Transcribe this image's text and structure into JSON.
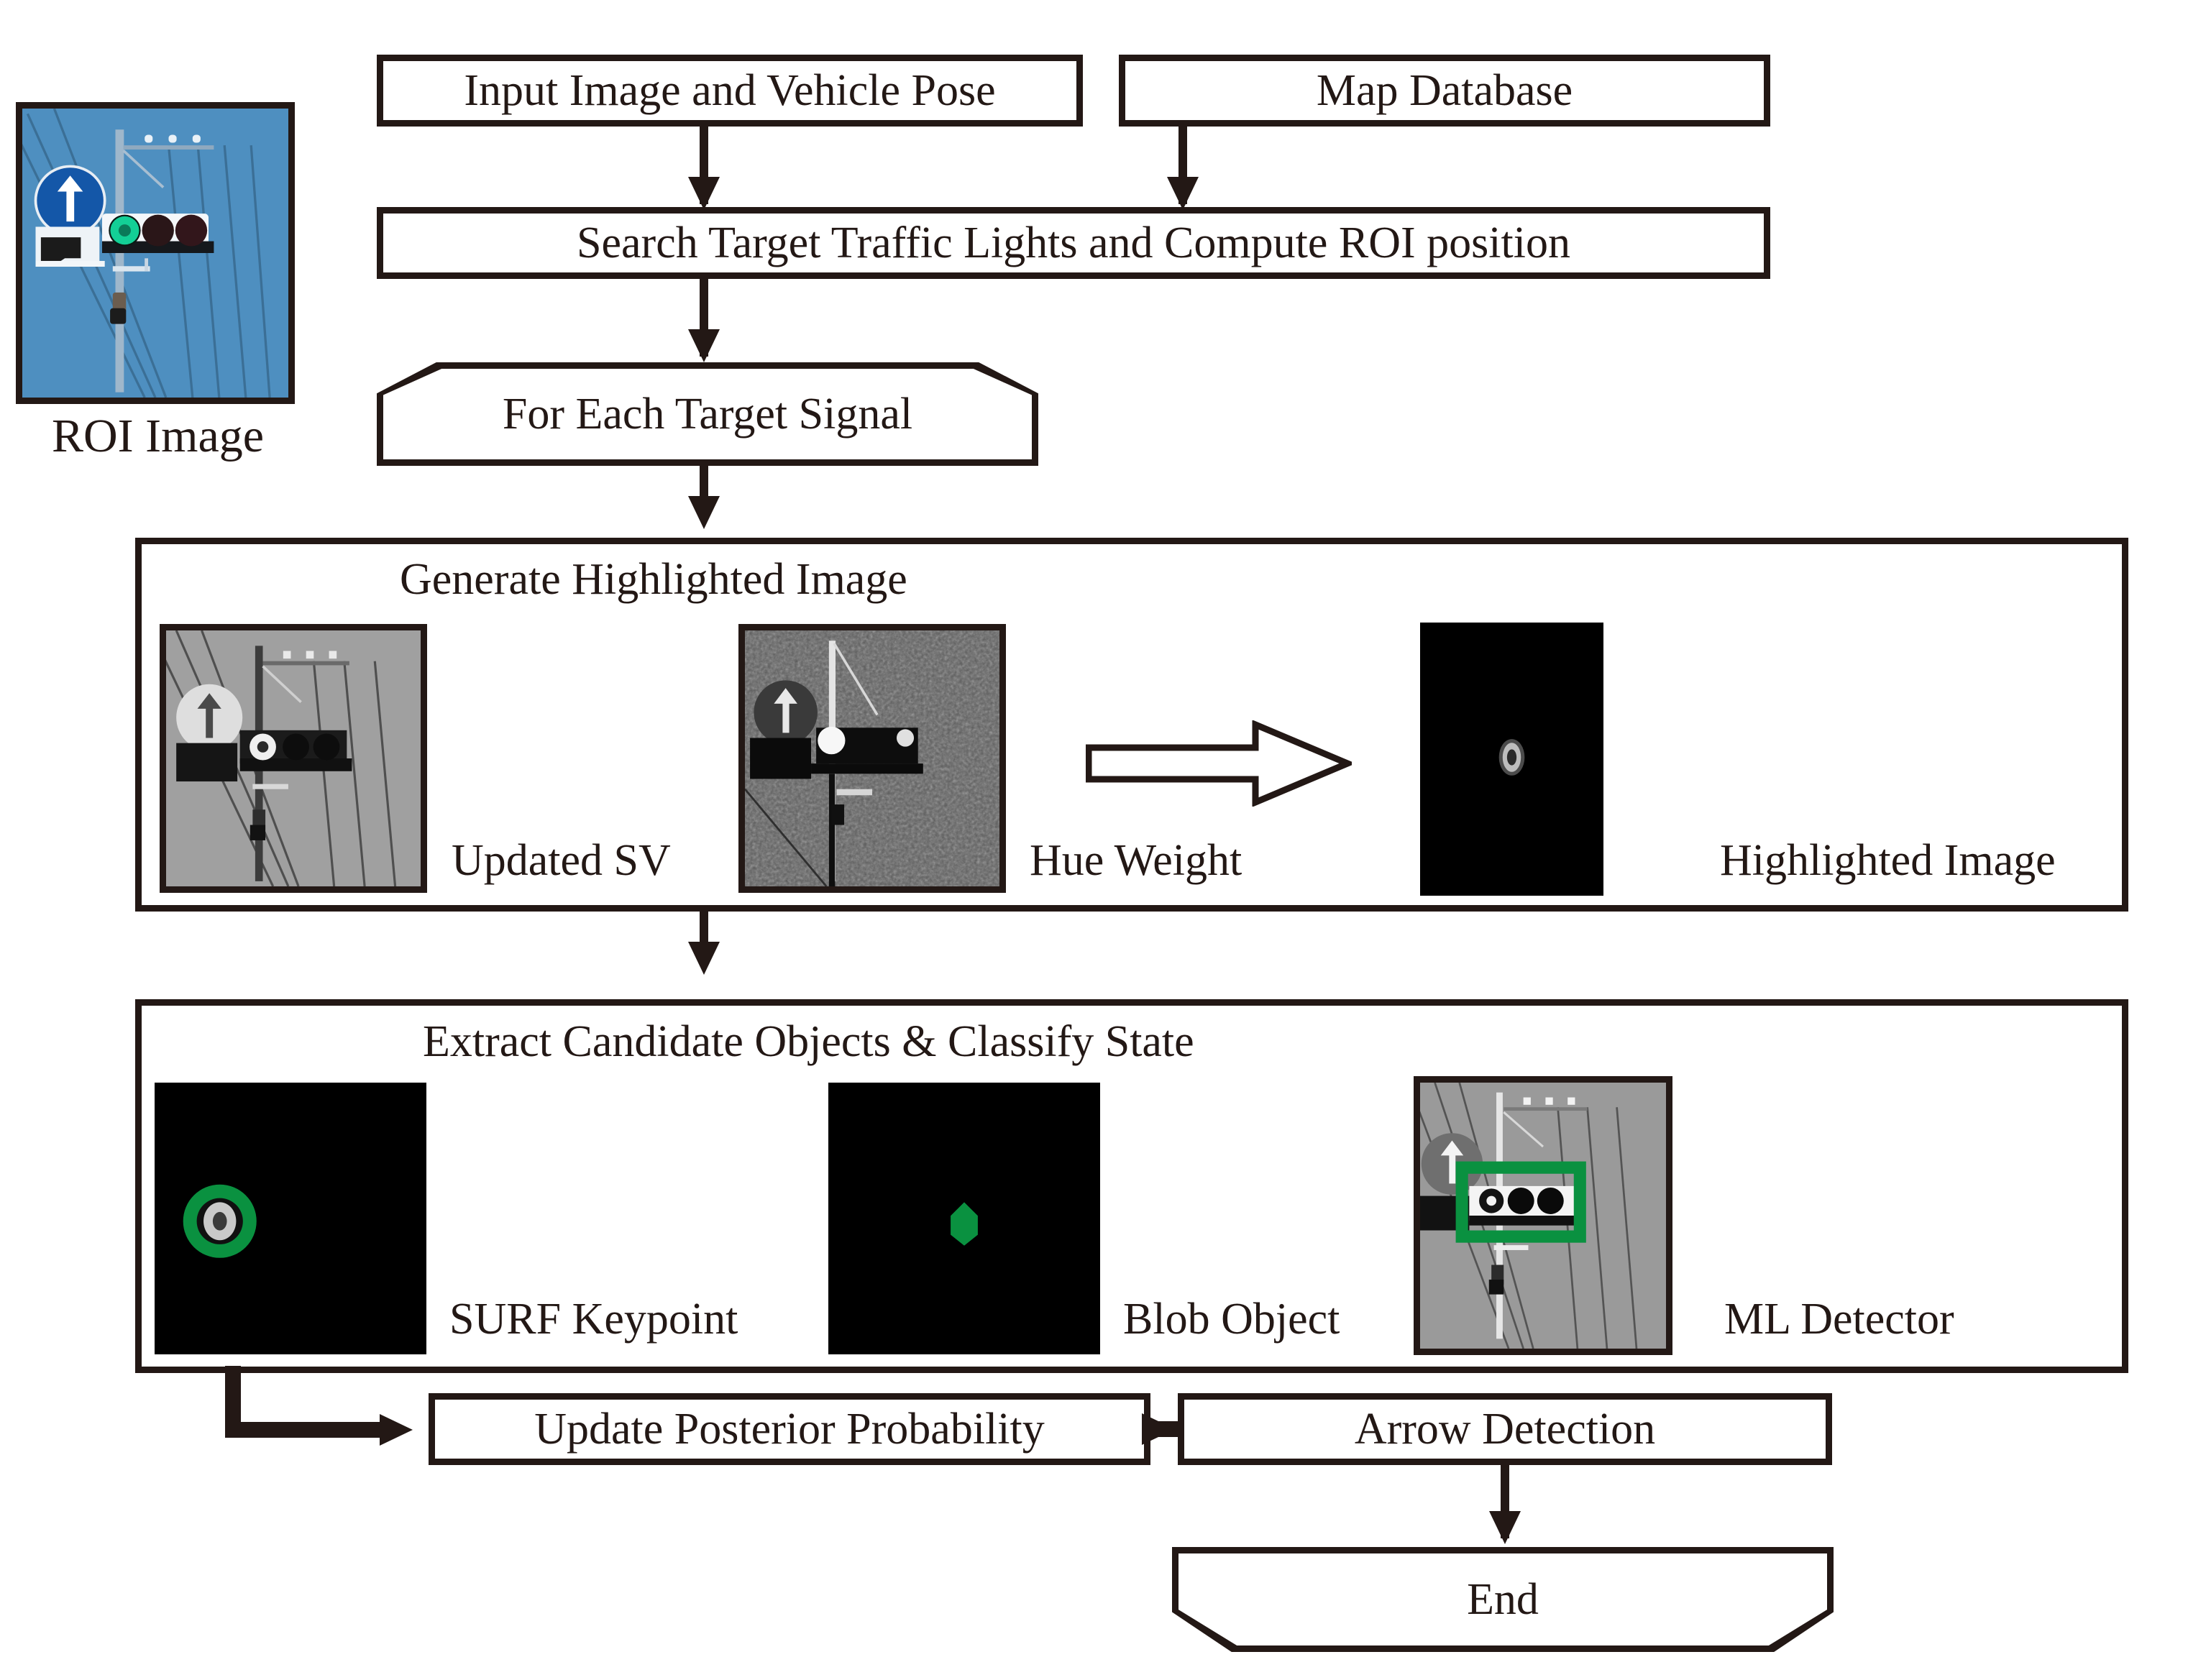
{
  "diagram": {
    "title": "Traffic Light Recognition Pipeline Flowchart",
    "colors": {
      "line": "#231815",
      "green_marker": "#0a9140",
      "sky_blue": "#4a8fc4",
      "sign_blue": "#1a5fb4",
      "signal_green": "#00c08a"
    }
  },
  "nodes": {
    "input_image_vehicle_pose": "Input Image and Vehicle Pose",
    "map_database": "Map Database",
    "search_target": "Search Target Traffic Lights and Compute ROI position",
    "for_each_target_signal": "For Each Target Signal",
    "update_posterior_probability": "Update Posterior Probability",
    "arrow_detection": "Arrow Detection",
    "end": "End"
  },
  "groups": {
    "generate_highlighted_image": {
      "title": "Generate Highlighted Image",
      "items": [
        {
          "caption": "Updated SV"
        },
        {
          "caption": "Hue Weight"
        },
        {
          "caption": "Highlighted Image"
        }
      ]
    },
    "extract_candidate_objects": {
      "title": "Extract Candidate Objects & Classify State",
      "items": [
        {
          "caption": "SURF Keypoint"
        },
        {
          "caption": "Blob Object"
        },
        {
          "caption": "ML Detector"
        }
      ]
    }
  },
  "roi": {
    "caption": "ROI Image"
  }
}
